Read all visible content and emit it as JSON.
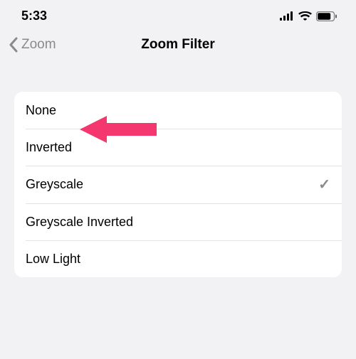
{
  "status": {
    "time": "5:33"
  },
  "nav": {
    "back_label": "Zoom",
    "title": "Zoom Filter"
  },
  "options": [
    {
      "label": "None",
      "selected": false
    },
    {
      "label": "Inverted",
      "selected": false
    },
    {
      "label": "Greyscale",
      "selected": true
    },
    {
      "label": "Greyscale Inverted",
      "selected": false
    },
    {
      "label": "Low Light",
      "selected": false
    }
  ],
  "annotation": {
    "points_to_option_index": 0,
    "color": "#f5376f"
  }
}
